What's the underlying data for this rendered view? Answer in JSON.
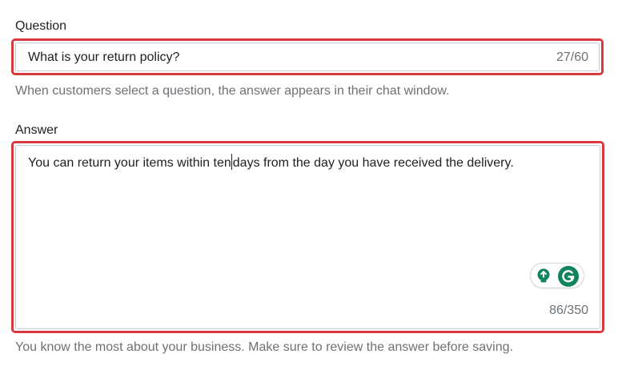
{
  "question": {
    "label": "Question",
    "value": "What is your return policy?",
    "counter": "27/60",
    "help": "When customers select a question, the answer appears in their chat window."
  },
  "answer": {
    "label": "Answer",
    "value_before_caret": "You can return your items within ten",
    "value_after_caret": "days from the day you have received the delivery.",
    "counter": "86/350",
    "help": "You know the most about your business. Make sure to review the answer before saving."
  },
  "grammarly": {
    "suggestion_icon": "lightbulb-icon",
    "logo_icon": "grammarly-icon",
    "accent_color": "#11845b"
  },
  "colors": {
    "highlight_border": "#d93a3f",
    "text": "#202223",
    "subdued_text": "#6d7175"
  }
}
